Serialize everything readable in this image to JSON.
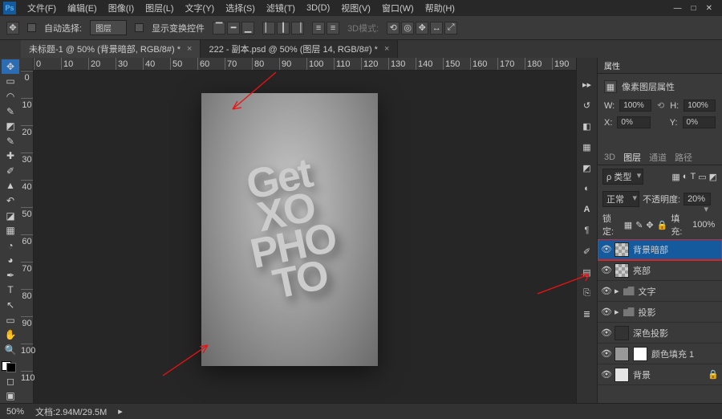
{
  "menubar": [
    "文件(F)",
    "编辑(E)",
    "图像(I)",
    "图层(L)",
    "文字(Y)",
    "选择(S)",
    "滤镜(T)",
    "3D(D)",
    "视图(V)",
    "窗口(W)",
    "帮助(H)"
  ],
  "options": {
    "auto_select": "自动选择:",
    "select_mode": "图层",
    "show_transform": "显示变换控件",
    "mode_3d": "3D模式:"
  },
  "tabs": [
    {
      "title": "未标题-1 @ 50% (背景暗部, RGB/8#) *",
      "active": true
    },
    {
      "title": "222 - 副本.psd @ 50% (图层 14, RGB/8#) *",
      "active": false
    }
  ],
  "hruler": [
    "0",
    "10",
    "20",
    "30",
    "40",
    "50",
    "60",
    "70",
    "80",
    "90",
    "100",
    "110",
    "120",
    "130",
    "140",
    "150",
    "160",
    "170",
    "180",
    "190"
  ],
  "vruler": [
    "0",
    "10",
    "20",
    "30",
    "40",
    "50",
    "60",
    "70",
    "80",
    "90",
    "100",
    "110"
  ],
  "status": {
    "zoom": "50%",
    "docinfo": "文档:2.94M/29.5M"
  },
  "properties": {
    "panel_title": "属性",
    "subtitle": "像素图层属性",
    "w_label": "W:",
    "w": "100%",
    "link": "⟲",
    "h_label": "H:",
    "h": "100%",
    "x_label": "X:",
    "x": "0%",
    "y_label": "Y:",
    "y": "0%"
  },
  "layers_panel": {
    "tabs": [
      "3D",
      "图层",
      "通道",
      "路径"
    ],
    "active_tab": "图层",
    "kind_label": "ρ 类型",
    "blend_mode": "正常",
    "opacity_label": "不透明度:",
    "opacity": "20%",
    "lock_label": "锁定:",
    "fill_label": "填充:",
    "fill": "100%"
  },
  "layers": [
    {
      "name": "背景暗部",
      "selected": true,
      "thumb": "checker"
    },
    {
      "name": "亮部",
      "thumb": "checker"
    },
    {
      "name": "文字",
      "folder": true
    },
    {
      "name": "投影",
      "folder": true
    },
    {
      "name": "深色投影",
      "thumb": "dark"
    },
    {
      "name": "颜色填充 1",
      "thumb": "fill",
      "mask": true
    },
    {
      "name": "背景",
      "thumb": "white",
      "locked": true
    }
  ],
  "artboard_text": [
    "Get",
    "XO",
    "PHO",
    "TO"
  ]
}
